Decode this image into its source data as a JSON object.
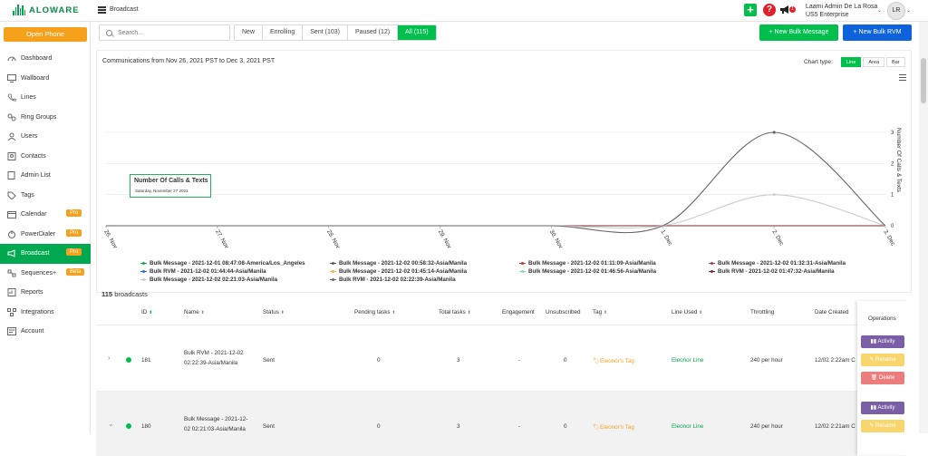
{
  "app": {
    "logo": "ALOWARE",
    "breadcrumb": "Broadcast"
  },
  "topbar": {
    "user_name": "Laami Admin De La Rosa",
    "company": "US5 Enterprise",
    "avatar": "LR",
    "notification_count": "1",
    "plus_icon": "plus-icon",
    "help_icon": "question-icon",
    "megaphone_icon": "megaphone-icon"
  },
  "sidebar": {
    "open_phone": "Open Phone",
    "items": [
      {
        "label": "Dashboard",
        "icon": "dashboard-icon"
      },
      {
        "label": "Wallboard",
        "icon": "monitor-icon"
      },
      {
        "label": "Lines",
        "icon": "phone-icon"
      },
      {
        "label": "Ring Groups",
        "icon": "ring-group-icon"
      },
      {
        "label": "Users",
        "icon": "user-icon"
      },
      {
        "label": "Contacts",
        "icon": "contacts-icon"
      },
      {
        "label": "Admin List",
        "icon": "list-icon"
      },
      {
        "label": "Tags",
        "icon": "tag-icon"
      },
      {
        "label": "Calendar",
        "icon": "calendar-icon",
        "badge": "Pro"
      },
      {
        "label": "PowerDialer",
        "icon": "power-dialer-icon",
        "badge": "Pro"
      },
      {
        "label": "Broadcast",
        "icon": "broadcast-icon",
        "badge": "Pro",
        "active": true
      },
      {
        "label": "Sequences+",
        "icon": "sequences-icon",
        "badge": "Beta"
      },
      {
        "label": "Reports",
        "icon": "reports-icon"
      },
      {
        "label": "Integrations",
        "icon": "integrations-icon"
      },
      {
        "label": "Account",
        "icon": "account-icon"
      }
    ]
  },
  "toolbar": {
    "search_placeholder": "Search...",
    "filters": [
      {
        "label": "New"
      },
      {
        "label": "Enrolling"
      },
      {
        "label": "Sent (103)"
      },
      {
        "label": "Paused (12)"
      },
      {
        "label": "All (115)",
        "active": true
      }
    ],
    "new_bulk_message": "+ New Bulk Message",
    "new_bulk_rvm": "+ New Bulk RVM"
  },
  "chart_panel": {
    "title": "Communications from Nov 26, 2021 PST to Dec 3, 2021 PST",
    "chart_type_label": "Chart type:",
    "chart_types": [
      "Line",
      "Area",
      "Bar"
    ],
    "active_chart_type": "Line",
    "tooltip_title": "Number Of Calls & Texts",
    "tooltip_date": "Saturday, November 27 2021"
  },
  "chart_data": {
    "type": "line",
    "x": [
      "26. Nov",
      "27. Nov",
      "28. Nov",
      "29. Nov",
      "30. Nov",
      "1. Dec",
      "2. Dec",
      "3. Dec"
    ],
    "ylabel": "Number Of Calls & Texts",
    "yticks": [
      "0",
      "1",
      "2",
      "3"
    ],
    "ylim": [
      0,
      3
    ],
    "series": [
      {
        "name": "Bulk Message - 2021-12-01 08:47:08-America/Los_Angeles",
        "color": "#1aa64a",
        "values": [
          0,
          0,
          0,
          0,
          0,
          0,
          0,
          0
        ]
      },
      {
        "name": "Bulk Message - 2021-12-02 00:58:32-Asia/Manila",
        "color": "#555555",
        "values": [
          0,
          0,
          0,
          0,
          0,
          0,
          0,
          0
        ]
      },
      {
        "name": "Bulk Message - 2021-12-02 01:11:09-Asia/Manila",
        "color": "#c0392b",
        "values": [
          0,
          0,
          0,
          0,
          0,
          0,
          0,
          0
        ]
      },
      {
        "name": "Bulk Message - 2021-12-02 01:32:31-Asia/Manila",
        "color": "#b03a3a",
        "values": [
          0,
          0,
          0,
          0,
          0,
          0,
          0,
          0
        ]
      },
      {
        "name": "Bulk RVM - 2021-12-02 01:44:44-Asia/Manila",
        "color": "#1e6fd9",
        "values": [
          0,
          0,
          0,
          0,
          0,
          0,
          0,
          0
        ]
      },
      {
        "name": "Bulk Message - 2021-12-02 01:45:14-Asia/Manila",
        "color": "#f5b041",
        "values": [
          0,
          0,
          0,
          0,
          0,
          0,
          0,
          0
        ]
      },
      {
        "name": "Bulk Message - 2021-12-02 01:46:56-Asia/Manila",
        "color": "#82e0aa",
        "values": [
          0,
          0,
          0,
          0,
          0,
          0,
          0,
          0
        ]
      },
      {
        "name": "Bulk RVM - 2021-12-02 01:47:32-Asia/Manila",
        "color": "#7f2a2a",
        "values": [
          0,
          0,
          0,
          0,
          0,
          0,
          0,
          0
        ]
      },
      {
        "name": "Bulk Message - 2021-12-02 02:21:03-Asia/Manila",
        "color": "#cccccc",
        "values": [
          0,
          0,
          0,
          0,
          0,
          0,
          1,
          0
        ]
      },
      {
        "name": "Bulk RVM - 2021-12-02 02:22:39-Asia/Manila",
        "color": "#666666",
        "values": [
          0,
          0,
          0,
          0,
          0,
          0,
          3,
          0
        ]
      }
    ]
  },
  "table": {
    "count": "115",
    "count_label": "broadcasts",
    "columns": [
      "ID",
      "Name",
      "Status",
      "Pending tasks",
      "Total tasks",
      "Engagement",
      "Unsubscribed",
      "Tag",
      "Line Used",
      "Throttling",
      "Date Created",
      "Operations"
    ],
    "rows": [
      {
        "id": "181",
        "name1": "Bulk RVM - 2021-12-02",
        "name2": "02:22:39-Asia/Manila",
        "status": "Sent",
        "pending": "0",
        "total": "3",
        "engagement": "-",
        "unsub": "0",
        "tag": "Eleonor's Tag",
        "line": "Eleonor Line",
        "throttling": "240 per hour",
        "date": "12/02 2:22am C"
      },
      {
        "id": "180",
        "name1": "Bulk Message - 2021-12-",
        "name2": "02 02:21:03-Asia/Manila",
        "status": "Sent",
        "pending": "0",
        "total": "3",
        "engagement": "-",
        "unsub": "0",
        "tag": "Eleonor's Tag",
        "line": "Eleonor Line",
        "throttling": "240 per hour",
        "date": "12/02 2:21am C"
      }
    ],
    "ops": {
      "activity": "Activity",
      "rename": "Rename",
      "delete": "Delete"
    }
  }
}
